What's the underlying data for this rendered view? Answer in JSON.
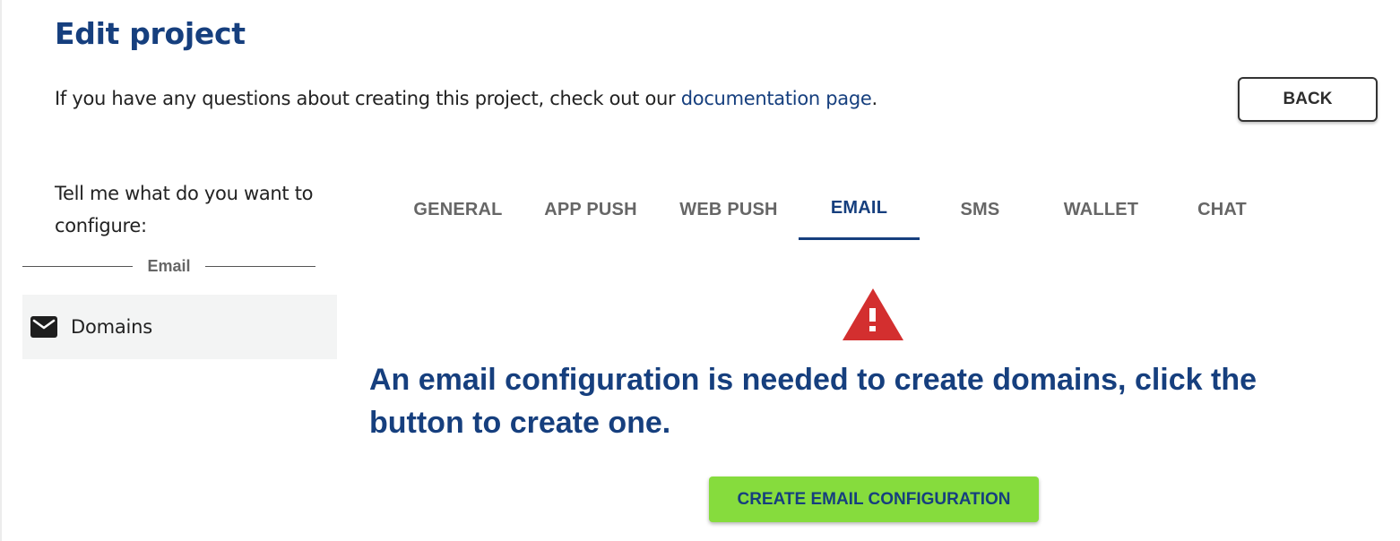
{
  "header": {
    "title": "Edit project",
    "intro_text": "If you have any questions about creating this project, check out our ",
    "intro_link": "documentation page",
    "intro_end": ".",
    "back_label": "BACK"
  },
  "sidebar": {
    "prompt": "Tell me what do you want to configure:",
    "section_label": "Email",
    "items": [
      {
        "label": "Domains",
        "icon": "mail-icon"
      }
    ]
  },
  "tabs": [
    {
      "label": "GENERAL",
      "active": false
    },
    {
      "label": "APP PUSH",
      "active": false
    },
    {
      "label": "WEB PUSH",
      "active": false
    },
    {
      "label": "EMAIL",
      "active": true
    },
    {
      "label": "SMS",
      "active": false
    },
    {
      "label": "WALLET",
      "active": false
    },
    {
      "label": "CHAT",
      "active": false
    }
  ],
  "main": {
    "warning_icon": "warning-icon",
    "message": "An email configuration is needed to create domains, click the button to create one.",
    "create_button_label": "CREATE EMAIL CONFIGURATION"
  },
  "colors": {
    "brand": "#163f7e",
    "warning": "#d32f2f",
    "create_button": "#86dc3d"
  }
}
